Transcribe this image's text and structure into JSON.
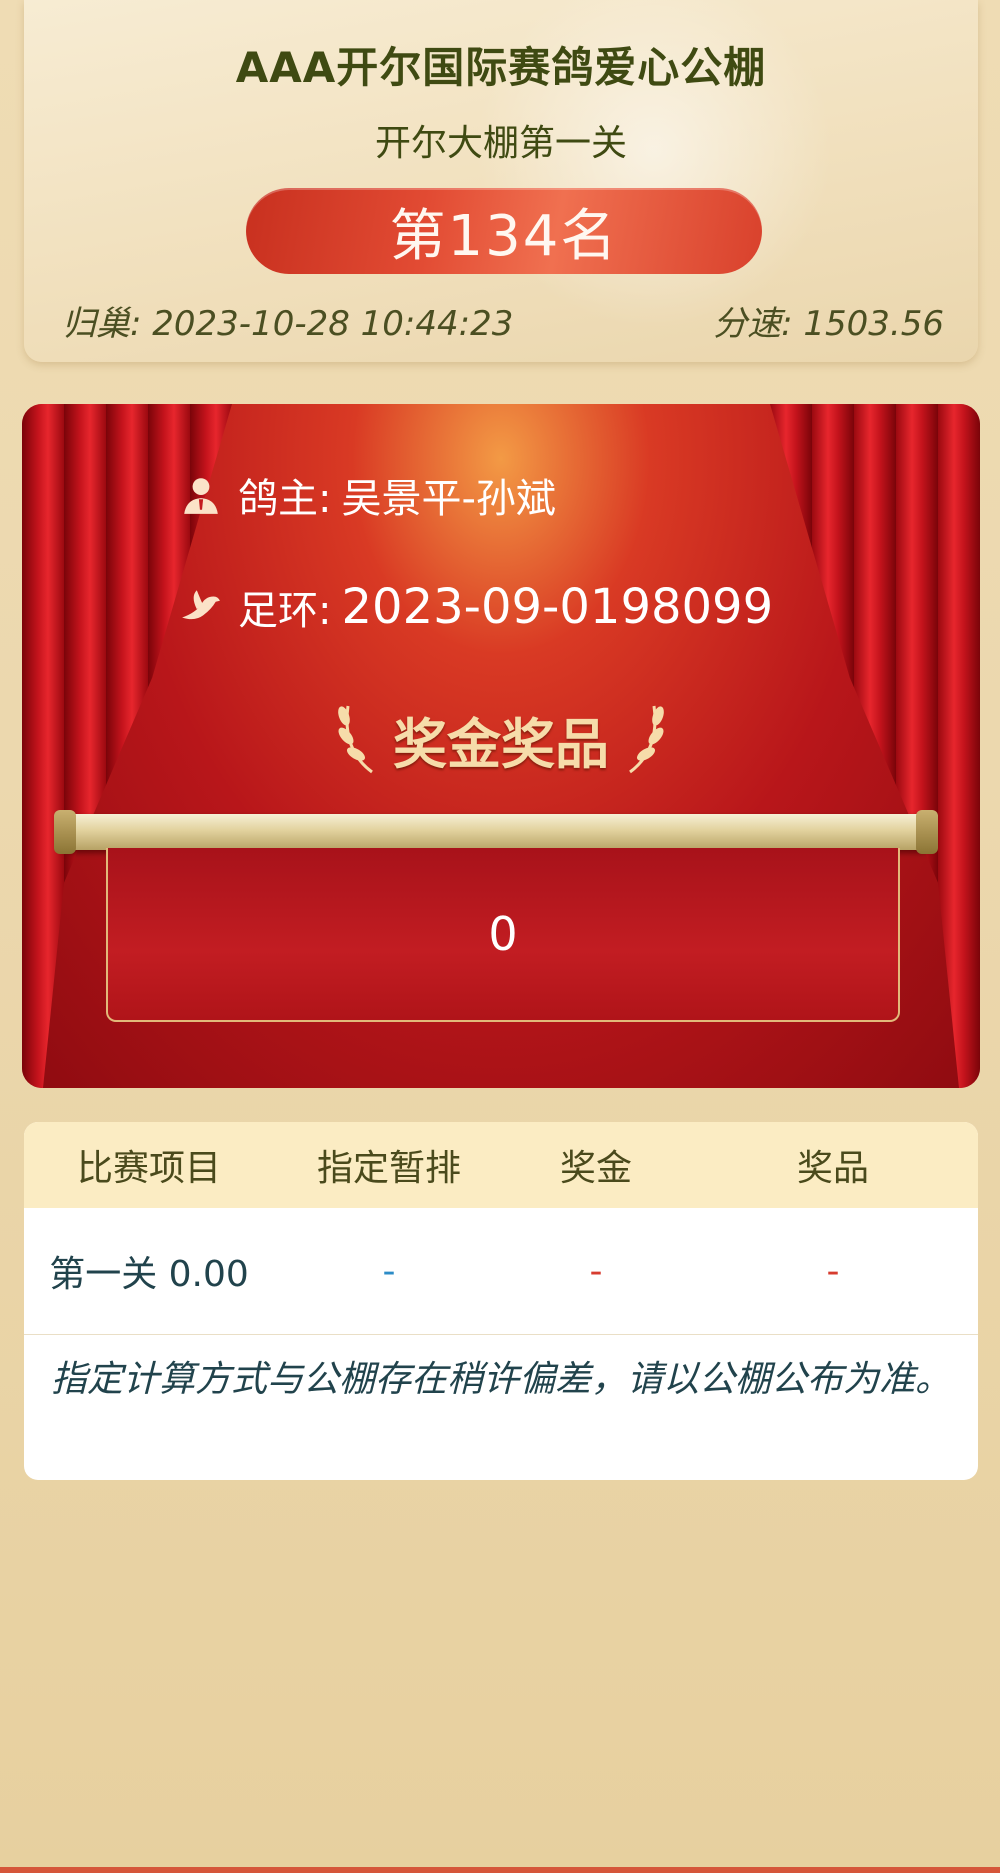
{
  "header": {
    "title": "AAA开尔国际赛鸽爱心公棚",
    "subtitle": "开尔大棚第一关",
    "rank": "第134名",
    "return_label": "归巢: 2023-10-28 10:44:23",
    "speed_label": "分速: 1503.56"
  },
  "stage": {
    "owner_label": "鸽主:",
    "owner_value": "吴景平-孙斌",
    "ring_label": "足环:",
    "ring_value": "2023-09-0198099",
    "award_title": "奖金奖品",
    "award_value": "0"
  },
  "table": {
    "headers": [
      "比赛项目",
      "指定暂排",
      "奖金",
      "奖品"
    ],
    "rows": [
      [
        "第一关 0.00",
        "-",
        "-",
        "-"
      ]
    ],
    "note": "指定计算方式与公棚存在稍许偏差，请以公棚公布为准。"
  },
  "colors": {
    "accent_red": "#d93a24",
    "title_olive": "#3f4a12",
    "header_bg": "#fbecc3"
  },
  "icons": {
    "owner": "person-icon",
    "ring": "pigeon-icon",
    "laurel": "laurel-icon"
  }
}
